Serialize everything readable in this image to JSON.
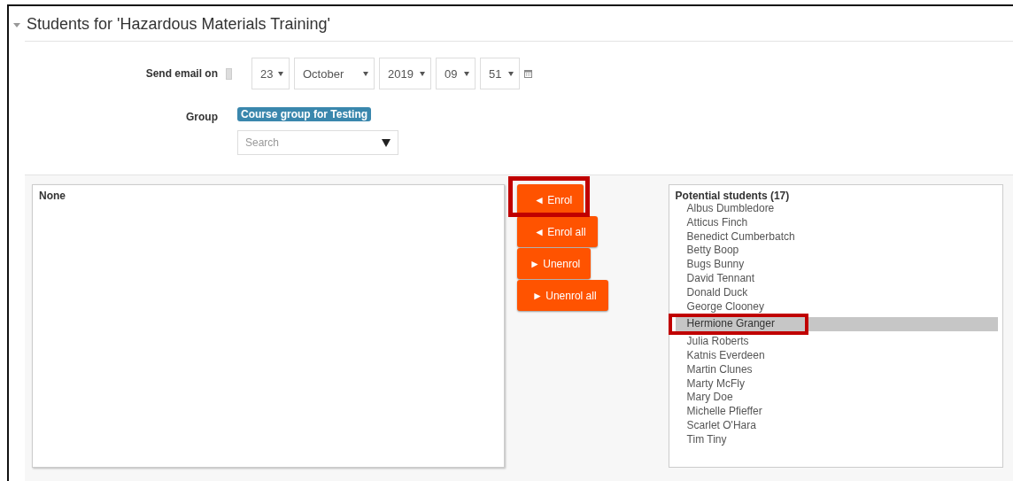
{
  "section": {
    "title": "Students for 'Hazardous Materials Training'",
    "expanded": true
  },
  "send_email": {
    "label": "Send email on",
    "fields": [
      {
        "value": "23"
      },
      {
        "value": "October"
      },
      {
        "value": "2019"
      },
      {
        "value": "09"
      },
      {
        "value": "51"
      }
    ]
  },
  "group": {
    "label": "Group",
    "tag": "Course group for Testing",
    "search": {
      "placeholder": "Search"
    }
  },
  "enrolled": {
    "label": "None"
  },
  "buttons": [
    {
      "label": "◄ Enrol",
      "annotated": true
    },
    {
      "label": "◄ Enrol all",
      "annotated": false
    },
    {
      "label": "► Unenrol",
      "annotated": false
    },
    {
      "label": "► Unenrol all",
      "annotated": false
    }
  ],
  "potential": {
    "label": "Potential students (17)",
    "options": [
      {
        "name": "Albus Dumbledore",
        "selected": false,
        "annotated": false
      },
      {
        "name": "Atticus Finch",
        "selected": false,
        "annotated": false
      },
      {
        "name": "Benedict Cumberbatch",
        "selected": false,
        "annotated": false
      },
      {
        "name": "Betty Boop",
        "selected": false,
        "annotated": false
      },
      {
        "name": "Bugs Bunny",
        "selected": false,
        "annotated": false
      },
      {
        "name": "David Tennant",
        "selected": false,
        "annotated": false
      },
      {
        "name": "Donald Duck",
        "selected": false,
        "annotated": false
      },
      {
        "name": "George Clooney",
        "selected": false,
        "annotated": false
      },
      {
        "name": "Hermione Granger",
        "selected": true,
        "annotated": true
      },
      {
        "name": "Julia Roberts",
        "selected": false,
        "annotated": false
      },
      {
        "name": "Katnis Everdeen",
        "selected": false,
        "annotated": false
      },
      {
        "name": "Martin Clunes",
        "selected": false,
        "annotated": false
      },
      {
        "name": "Marty McFly",
        "selected": false,
        "annotated": false
      },
      {
        "name": "Mary Doe",
        "selected": false,
        "annotated": false
      },
      {
        "name": "Michelle Pfieffer",
        "selected": false,
        "annotated": false
      },
      {
        "name": "Scarlet O'Hara",
        "selected": false,
        "annotated": false
      },
      {
        "name": "Tim Tiny",
        "selected": false,
        "annotated": false
      }
    ]
  }
}
